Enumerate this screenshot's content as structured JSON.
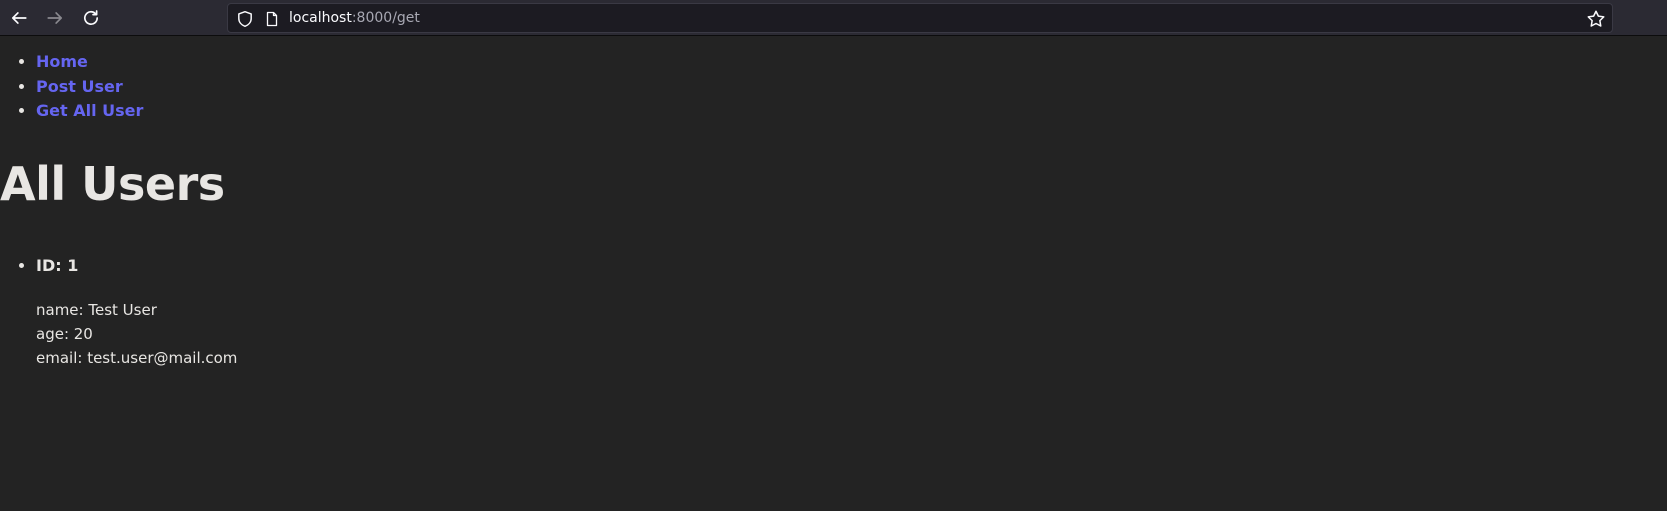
{
  "browser": {
    "url_host": "localhost",
    "url_rest": ":8000/get"
  },
  "nav": {
    "items": [
      {
        "label": "Home"
      },
      {
        "label": "Post User"
      },
      {
        "label": "Get All User"
      }
    ],
    "link_color": "#6565f0"
  },
  "page": {
    "title": "All Users"
  },
  "users": [
    {
      "id_label": "ID: 1",
      "name_line": "name: Test User",
      "age_line": "age: 20",
      "email_line": "email: test.user@mail.com"
    }
  ],
  "colors": {
    "background": "#232323",
    "text": "#e8e6e3",
    "toolbar": "#2b2a33",
    "urlbar": "#1c1b22"
  }
}
